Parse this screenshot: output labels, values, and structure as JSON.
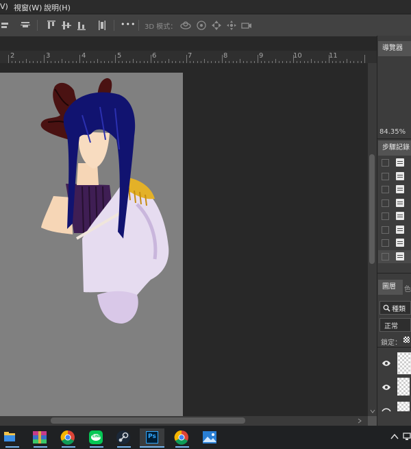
{
  "menu": {
    "items": [
      {
        "label": "V)"
      },
      {
        "label": "視窗(W)"
      },
      {
        "label": "說明(H)"
      }
    ]
  },
  "options_bar": {
    "label_3d": "3D 模式：",
    "more_glyph": "•••"
  },
  "ruler": {
    "numbers": [
      "2",
      "3",
      "4",
      "5",
      "6",
      "7",
      "8",
      "9",
      "10",
      "11"
    ]
  },
  "panels": {
    "navigator": {
      "tab_label": "導覽器",
      "zoom": "84.35%"
    },
    "history": {
      "tab_label": "步驟記錄",
      "item_count": 8
    },
    "layers": {
      "tab_label": "圖層",
      "tab2_label": "色",
      "filter_label": "種類",
      "blend_mode": "正常",
      "lock_label": "鎖定："
    }
  },
  "taskbar": {
    "apps": [
      "file-explorer",
      "winrar",
      "chrome",
      "line",
      "steam",
      "photoshop",
      "chrome",
      "photos"
    ],
    "ps_label": "Ps",
    "line_label": "LINE"
  },
  "colors": {
    "app_bg": "#282828",
    "canvas_bg": "#808080",
    "panel_bg": "#3c3c3c",
    "accent": "#77b7f0"
  }
}
